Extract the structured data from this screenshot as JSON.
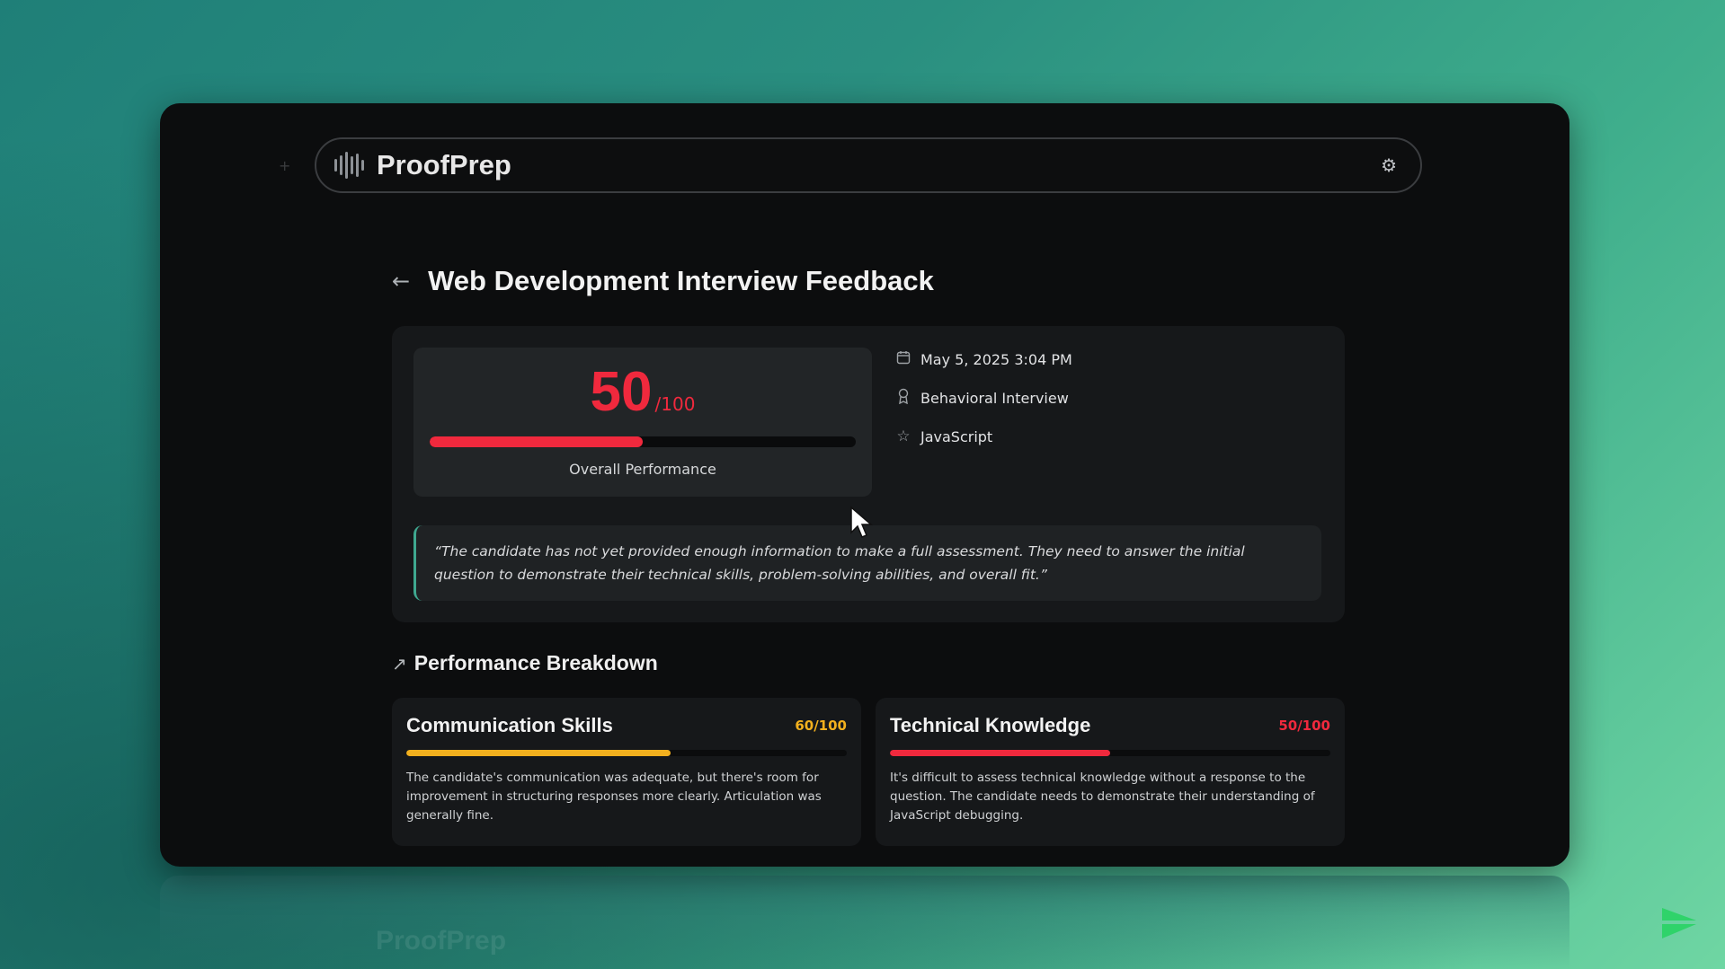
{
  "app": {
    "name": "ProofPrep"
  },
  "header": {
    "settings_icon": "gear-icon"
  },
  "page": {
    "title": "Web Development Interview Feedback",
    "back_icon": "arrow-left-icon"
  },
  "summary": {
    "score": "50",
    "score_max": "/100",
    "score_fraction": 0.5,
    "label": "Overall Performance",
    "score_color": "#f0293d",
    "meta": [
      {
        "icon": "calendar-icon",
        "text": "May 5, 2025 3:04 PM"
      },
      {
        "icon": "badge-icon",
        "text": "Behavioral Interview"
      },
      {
        "icon": "star-icon",
        "text": "JavaScript"
      }
    ],
    "feedback": "“The candidate has not yet provided enough information to make a full assessment. They need to answer the initial question to demonstrate their technical skills, problem-solving abilities, and overall fit.”"
  },
  "breakdown": {
    "title": "Performance Breakdown",
    "icon": "trend-up-icon",
    "skills": [
      {
        "name": "Communication Skills",
        "score": "60/100",
        "fraction": 0.6,
        "color": "#f2b01e",
        "description": "The candidate's communication was adequate, but there's room for improvement in structuring responses more clearly. Articulation was generally fine."
      },
      {
        "name": "Technical Knowledge",
        "score": "50/100",
        "fraction": 0.5,
        "color": "#f0293d",
        "description": "It's difficult to assess technical knowledge without a response to the question. The candidate needs to demonstrate their understanding of JavaScript debugging."
      }
    ]
  },
  "colors": {
    "accent": "#3fa890",
    "card": "#16181a",
    "background": "#0c0d0e"
  }
}
